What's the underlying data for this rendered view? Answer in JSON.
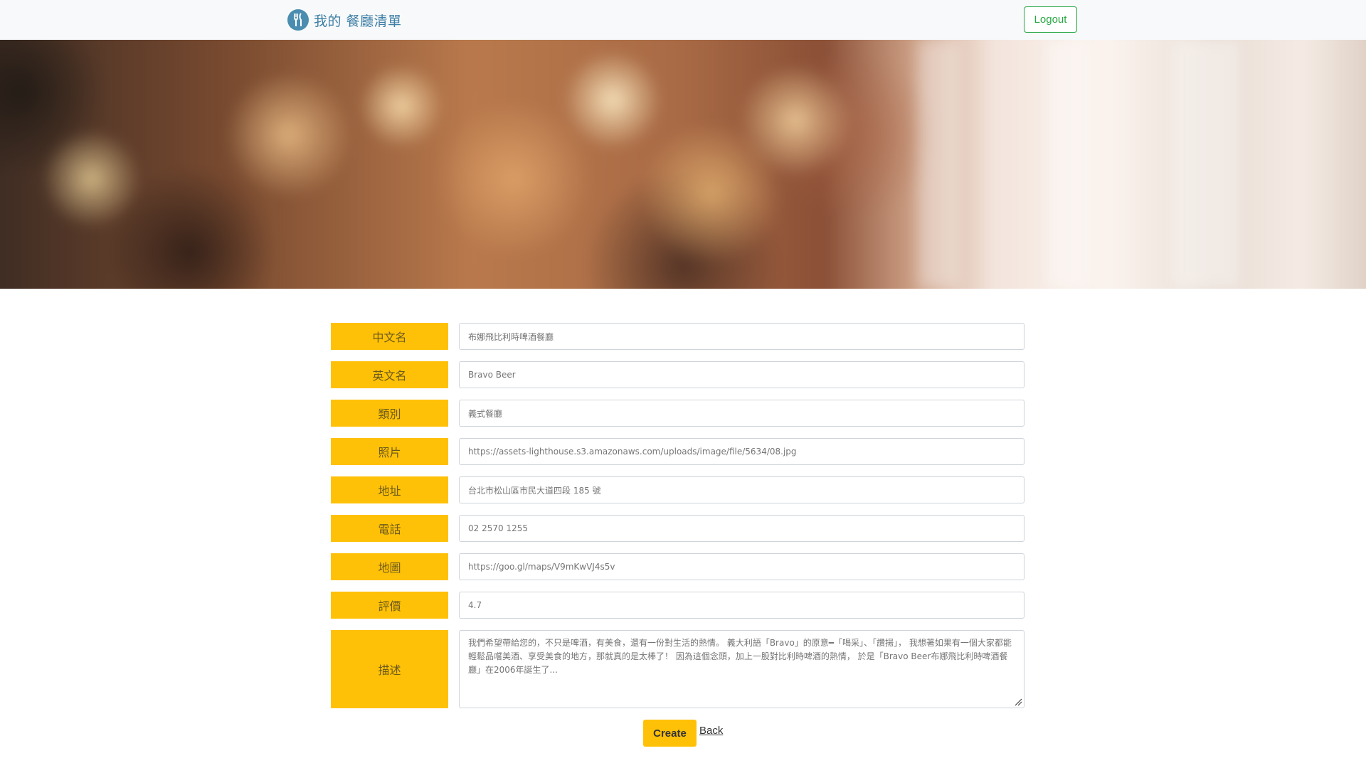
{
  "navbar": {
    "brand": "我的 餐廳清單",
    "brand_icon": "utensils-icon",
    "logout_label": "Logout",
    "accent_color": "#28a745"
  },
  "hero": {
    "description_icon": "restaurant-blurred-photo"
  },
  "form": {
    "label_color": "#ffc107",
    "fields": [
      {
        "label": "中文名",
        "value": "布娜飛比利時啤酒餐廳"
      },
      {
        "label": "英文名",
        "value": "Bravo Beer"
      },
      {
        "label": "類別",
        "value": "義式餐廳"
      },
      {
        "label": "照片",
        "value": "https://assets-lighthouse.s3.amazonaws.com/uploads/image/file/5634/08.jpg"
      },
      {
        "label": "地址",
        "value": "台北市松山區市民大道四段 185 號"
      },
      {
        "label": "電話",
        "value": "02 2570 1255"
      },
      {
        "label": "地圖",
        "value": "https://goo.gl/maps/V9mKwVJ4s5v"
      },
      {
        "label": "評價",
        "value": "4.7"
      }
    ],
    "description": {
      "label": "描述",
      "value": "我們希望帶給您的，不只是啤酒，有美食，還有一份對生活的熱情。 義大利語「Bravo」的原意━「喝采」、「讚揚」， 我想著如果有一個大家都能輕鬆品嚐美酒、享受美食的地方，那就真的是太棒了！ 因為這個念頭，加上一股對比利時啤酒的熱情， 於是「Bravo Beer布娜飛比利時啤酒餐廳」在2006年誕生了..."
    },
    "create_label": "Create",
    "back_label": "Back"
  }
}
